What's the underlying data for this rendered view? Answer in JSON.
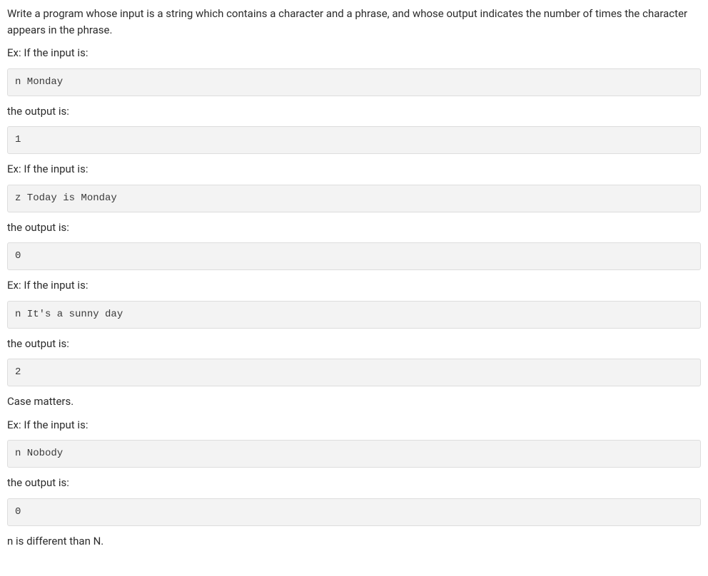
{
  "intro": "Write a program whose input is a string which contains a character and a phrase, and whose output indicates the number of times the character appears in the phrase.",
  "examples": [
    {
      "input_label": "Ex: If the input is:",
      "input": "n Monday",
      "output_label": "the output is:",
      "output": "1"
    },
    {
      "input_label": "Ex: If the input is:",
      "input": "z Today is Monday",
      "output_label": "the output is:",
      "output": "0"
    },
    {
      "input_label": "Ex: If the input is:",
      "input": "n It's a sunny day",
      "output_label": "the output is:",
      "output": "2"
    }
  ],
  "case_note": "Case matters.",
  "case_example": {
    "input_label": "Ex: If the input is:",
    "input": "n Nobody",
    "output_label": "the output is:",
    "output": "0"
  },
  "final_note": "n is different than N."
}
